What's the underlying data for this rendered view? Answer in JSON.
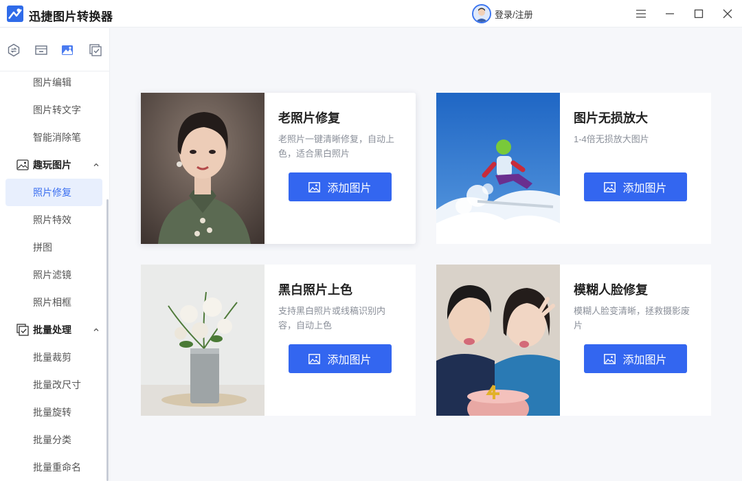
{
  "app": {
    "title": "迅捷图片转换器"
  },
  "header": {
    "login_label": "登录/注册"
  },
  "sidebar": {
    "items_top": [
      {
        "label": "图片编辑"
      },
      {
        "label": "图片转文字"
      },
      {
        "label": "智能消除笔"
      }
    ],
    "group_fun": {
      "label": "趣玩图片"
    },
    "fun_items": [
      {
        "label": "照片修复",
        "active": true
      },
      {
        "label": "照片特效"
      },
      {
        "label": "拼图"
      },
      {
        "label": "照片滤镜"
      },
      {
        "label": "照片相框"
      }
    ],
    "group_batch": {
      "label": "批量处理"
    },
    "batch_items": [
      {
        "label": "批量裁剪"
      },
      {
        "label": "批量改尺寸"
      },
      {
        "label": "批量旋转"
      },
      {
        "label": "批量分类"
      },
      {
        "label": "批量重命名"
      }
    ]
  },
  "cards": [
    {
      "title": "老照片修复",
      "desc": "老照片一键清晰修复，自动上色，适合黑白照片",
      "button": "添加图片"
    },
    {
      "title": "图片无损放大",
      "desc": "1-4倍无损放大图片",
      "button": "添加图片"
    },
    {
      "title": "黑白照片上色",
      "desc": "支持黑白照片或线稿识别内容，自动上色",
      "button": "添加图片"
    },
    {
      "title": "模糊人脸修复",
      "desc": "模糊人脸变清晰，拯救摄影废片",
      "button": "添加图片"
    }
  ],
  "colors": {
    "accent": "#3366f0",
    "active_bg": "#e8effd",
    "active_text": "#3b6ff0"
  },
  "icons": {
    "window": [
      "menu-icon",
      "minimize-icon",
      "maximize-icon",
      "close-icon"
    ],
    "categories": [
      "convert-icon",
      "compress-icon",
      "image-icon",
      "batch-icon"
    ]
  }
}
